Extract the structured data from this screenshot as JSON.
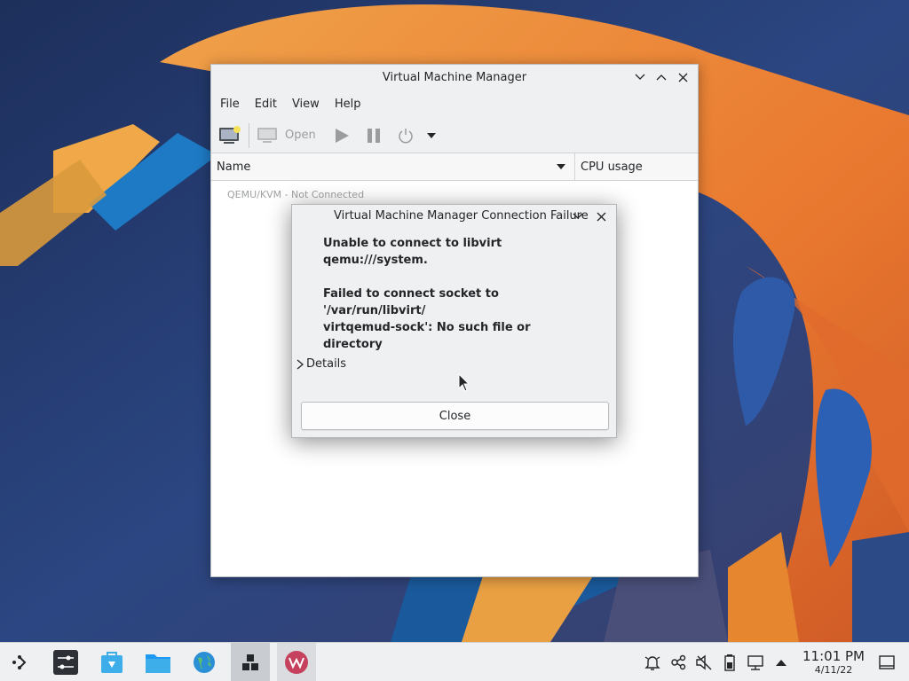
{
  "main_window": {
    "title": "Virtual Machine Manager",
    "menu": [
      "File",
      "Edit",
      "View",
      "Help"
    ],
    "toolbar": {
      "new_vm_icon": "new-vm-icon",
      "open_label": "Open",
      "icons": [
        "monitor-icon",
        "play-icon",
        "pause-icon",
        "power-icon",
        "dropdown-arrow-icon"
      ]
    },
    "columns": {
      "name": "Name",
      "cpu": "CPU usage"
    },
    "connection": "QEMU/KVM - Not Connected"
  },
  "dialog": {
    "title": "Virtual Machine Manager Connection Failure",
    "primary": "Unable to connect to libvirt qemu:///system.",
    "secondary_line1": "Failed to connect socket to '/var/run/libvirt/",
    "secondary_line2": "virtqemud-sock': No such file or",
    "secondary_line3": "directory",
    "details_label": "Details",
    "close_label": "Close"
  },
  "taskbar": {
    "apps": [
      "application-launcher-icon",
      "system-settings-icon",
      "discover-icon",
      "file-manager-icon",
      "web-browser-icon",
      "pager-icon",
      "virt-manager-icon"
    ],
    "tray": [
      "notifications-icon",
      "kde-connect-icon",
      "volume-muted-icon",
      "battery-icon",
      "network-icon",
      "expand-tray-icon"
    ],
    "time": "11:01 PM",
    "date": "4/11/22"
  },
  "colors": {
    "accent": "#3daee9",
    "window_bg": "#eff0f1",
    "text": "#232629"
  }
}
